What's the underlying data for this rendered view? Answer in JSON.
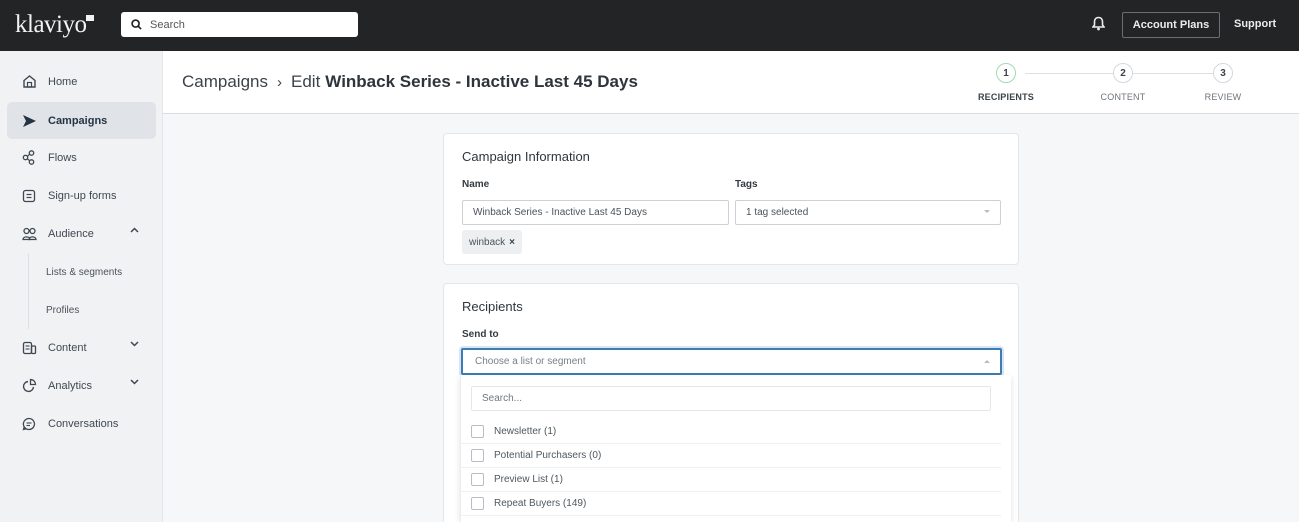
{
  "topbar": {
    "logo": "klaviyo",
    "search_placeholder": "Search",
    "account_plans_label": "Account Plans",
    "support_label": "Support",
    "icons": {
      "search": "search-icon",
      "notifications": "bell-icon"
    }
  },
  "sidebar": {
    "items": [
      {
        "label": "Home",
        "icon": "home-icon",
        "active": false
      },
      {
        "label": "Campaigns",
        "icon": "campaigns-send-icon",
        "active": true
      },
      {
        "label": "Flows",
        "icon": "flows-icon",
        "active": false
      },
      {
        "label": "Sign-up forms",
        "icon": "form-icon",
        "active": false
      },
      {
        "label": "Audience",
        "icon": "audience-icon",
        "active": false,
        "expanded": true
      },
      {
        "label": "Content",
        "icon": "content-icon",
        "active": false,
        "expanded": false
      },
      {
        "label": "Analytics",
        "icon": "analytics-icon",
        "active": false,
        "expanded": false
      },
      {
        "label": "Conversations",
        "icon": "conversations-icon",
        "active": false
      }
    ],
    "audience_subitems": [
      {
        "label": "Lists & segments"
      },
      {
        "label": "Profiles"
      }
    ]
  },
  "header": {
    "breadcrumb_root": "Campaigns",
    "breadcrumb_separator": "›",
    "edit_prefix": "Edit",
    "campaign_title": "Winback Series - Inactive Last 45 Days",
    "steps": [
      {
        "number": "1",
        "label": "RECIPIENTS",
        "current": true
      },
      {
        "number": "2",
        "label": "CONTENT",
        "current": false
      },
      {
        "number": "3",
        "label": "REVIEW",
        "current": false
      }
    ],
    "colors": {
      "current_step_ring": "#9ddcb0"
    }
  },
  "campaign_info": {
    "title": "Campaign Information",
    "name_label": "Name",
    "name_value": "Winback Series - Inactive Last 45 Days",
    "tags_label": "Tags",
    "tags_value": "1 tag selected",
    "tag_chips": [
      {
        "label": "winback",
        "remove": "×"
      }
    ]
  },
  "recipients": {
    "title": "Recipients",
    "send_to_label": "Send to",
    "send_to_placeholder": "Choose a list or segment",
    "dropdown": {
      "search_placeholder": "Search...",
      "options": [
        {
          "label": "Newsletter (1)",
          "checked": false
        },
        {
          "label": "Potential Purchasers (0)",
          "checked": false
        },
        {
          "label": "Preview List (1)",
          "checked": false
        },
        {
          "label": "Repeat Buyers (149)",
          "checked": false
        }
      ]
    },
    "colors": {
      "focus_border": "#3e7cb1"
    }
  }
}
